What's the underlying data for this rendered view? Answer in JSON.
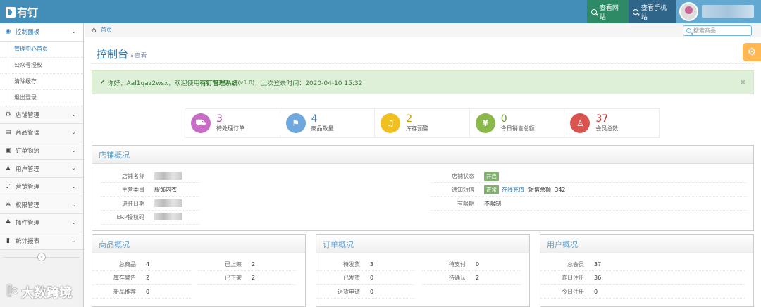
{
  "app": {
    "logo": "有钉"
  },
  "topbar": {
    "view_site": "查看网站",
    "view_mobile": "查看手机站"
  },
  "sidebar": {
    "items": [
      {
        "label": "控制面板",
        "icon": "dashboard-icon",
        "glyph": "◉"
      },
      {
        "label": "店铺管理",
        "icon": "gear-icon",
        "glyph": "⚙"
      },
      {
        "label": "商品管理",
        "icon": "list-icon",
        "glyph": "▤"
      },
      {
        "label": "订单物流",
        "icon": "credit-card-icon",
        "glyph": "▣"
      },
      {
        "label": "用户管理",
        "icon": "user-icon",
        "glyph": "♟"
      },
      {
        "label": "营销管理",
        "icon": "bell-icon",
        "glyph": "♪"
      },
      {
        "label": "权限管理",
        "icon": "cogs-icon",
        "glyph": "✲"
      },
      {
        "label": "插件管理",
        "icon": "sitemap-icon",
        "glyph": "♣"
      },
      {
        "label": "统计报表",
        "icon": "signal-icon",
        "glyph": "▮"
      }
    ],
    "subitems": [
      "管理中心首页",
      "公众号授权",
      "清除缓存",
      "退出登录"
    ],
    "collapse": "«"
  },
  "breadcrumb": {
    "home": "首页"
  },
  "search": {
    "placeholder": "搜索商品..."
  },
  "page": {
    "title": "控制台",
    "subtitle": "»查看"
  },
  "alert": {
    "prefix": "你好，Aal1qaz2wsx，欢迎使用 ",
    "system": "有钉管理系统",
    "version": "(v1.0)",
    "suffix": "，上次登录时间：2020-04-10 15:32"
  },
  "stats": [
    {
      "num": "3",
      "label": "待处理订单",
      "color": "#c86cc8",
      "numcolor": "#a24ba2",
      "icon": "cart-icon",
      "glyph": "⛟"
    },
    {
      "num": "4",
      "label": "商品数量",
      "color": "#6fa8dc",
      "numcolor": "#3a86c8",
      "icon": "flag-icon",
      "glyph": "⚑"
    },
    {
      "num": "2",
      "label": "库存预警",
      "color": "#f0c020",
      "numcolor": "#d49a00",
      "icon": "bell-icon",
      "glyph": "♫"
    },
    {
      "num": "0",
      "label": "今日销售总额",
      "color": "#8bb84a",
      "numcolor": "#6a9a2c",
      "icon": "yen-icon",
      "glyph": "¥"
    },
    {
      "num": "37",
      "label": "会员总数",
      "color": "#d9534f",
      "numcolor": "#c9302c",
      "icon": "user-icon",
      "glyph": "♙"
    }
  ],
  "shop": {
    "title": "店铺概况",
    "left": [
      {
        "k": "店铺名称",
        "v": ""
      },
      {
        "k": "主营类目",
        "v": "服饰内衣"
      },
      {
        "k": "进驻日期",
        "v": ""
      },
      {
        "k": "ERP授权码",
        "v": ""
      }
    ],
    "right": [
      {
        "k": "店铺状态",
        "badge": "开启",
        "badge_color": "#82af6f"
      },
      {
        "k": "通知短信",
        "badge": "正常",
        "badge_color": "#82af6f",
        "link": "在线充值",
        "extra": "短信余额: 342"
      },
      {
        "k": "有限期",
        "v": "不限制"
      }
    ]
  },
  "goods": {
    "title": "商品概况",
    "left": [
      {
        "k": "总商品",
        "v": "4"
      },
      {
        "k": "库存警告",
        "v": "2"
      },
      {
        "k": "新品推荐",
        "v": "0"
      }
    ],
    "right": [
      {
        "k": "已上架",
        "v": "2"
      },
      {
        "k": "已下架",
        "v": "2"
      }
    ]
  },
  "orders": {
    "title": "订单概况",
    "left": [
      {
        "k": "待发货",
        "v": "3"
      },
      {
        "k": "已发货",
        "v": "0"
      },
      {
        "k": "退货申请",
        "v": "0"
      }
    ],
    "right": [
      {
        "k": "待支付",
        "v": "0"
      },
      {
        "k": "待确认",
        "v": "2"
      }
    ]
  },
  "users": {
    "title": "用户概况",
    "rows": [
      {
        "k": "总会员",
        "v": "37"
      },
      {
        "k": "昨日注册",
        "v": "36"
      },
      {
        "k": "今日注册",
        "v": "0"
      }
    ]
  },
  "watermark": "大数跨境"
}
